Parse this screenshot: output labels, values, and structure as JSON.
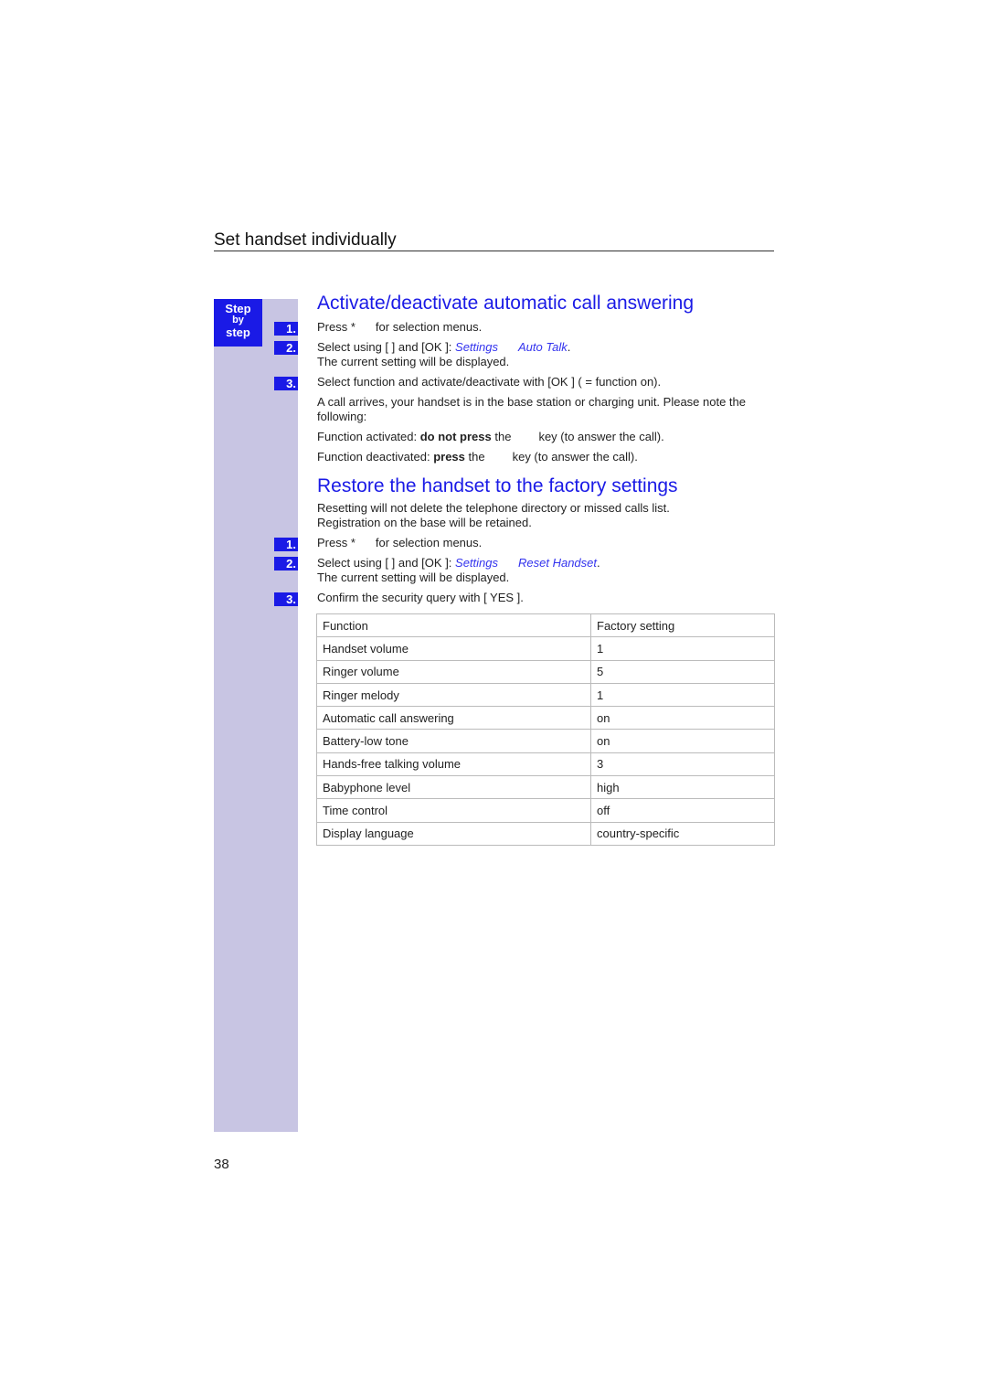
{
  "header": {
    "title": "Set handset individually"
  },
  "sidebar": {
    "badge": [
      "Step",
      "by",
      "step"
    ]
  },
  "section1": {
    "title": "Activate/deactivate automatic call answering",
    "steps": [
      {
        "num": "1.",
        "text_a": "Press *",
        "text_b": "for selection menus."
      },
      {
        "num": "2.",
        "text_a": "Select using [   ] and [OK ]: ",
        "link1": "Settings",
        "link2": "Auto Talk",
        "text_end": ".",
        "line2": "The current setting will be displayed."
      },
      {
        "num": "3.",
        "text": "Select function and activate/deactivate with [OK ] (    = function on)."
      }
    ],
    "note": "A call arrives, your handset is in the base station or charging unit. Please note the following:",
    "activated": {
      "label": "Function activated: ",
      "bold": "do not press",
      "rest_a": " the",
      "rest_b": "key (to answer the call)."
    },
    "deactivated": {
      "label": "Function deactivated: ",
      "bold": "press",
      "rest_a": " the",
      "rest_b": "key (to answer the call)."
    }
  },
  "section2": {
    "title": "Restore the handset to the factory settings",
    "intro1": "Resetting will not delete the telephone directory or missed calls list.",
    "intro2": "Registration on the base will be retained.",
    "steps": [
      {
        "num": "1.",
        "text_a": "Press *",
        "text_b": "for selection menus."
      },
      {
        "num": "2.",
        "text_a": "Select using [   ] and [OK ]: ",
        "link1": "Settings",
        "link2": "Reset Handset",
        "text_end": ".",
        "line2": "The current setting will be displayed."
      },
      {
        "num": "3.",
        "text": "Confirm the security query with [ YES   ]."
      }
    ]
  },
  "table": {
    "headers": [
      "Function",
      "Factory setting"
    ],
    "rows": [
      [
        "Handset volume",
        "1"
      ],
      [
        "Ringer volume",
        "5"
      ],
      [
        "Ringer melody",
        "1"
      ],
      [
        "Automatic call answering",
        "on"
      ],
      [
        "Battery-low tone",
        "on"
      ],
      [
        "Hands-free talking volume",
        "3"
      ],
      [
        "Babyphone level",
        "high"
      ],
      [
        "Time control",
        "off"
      ],
      [
        "Display language",
        "country-specific"
      ]
    ]
  },
  "footer": {
    "page_number": "38"
  }
}
